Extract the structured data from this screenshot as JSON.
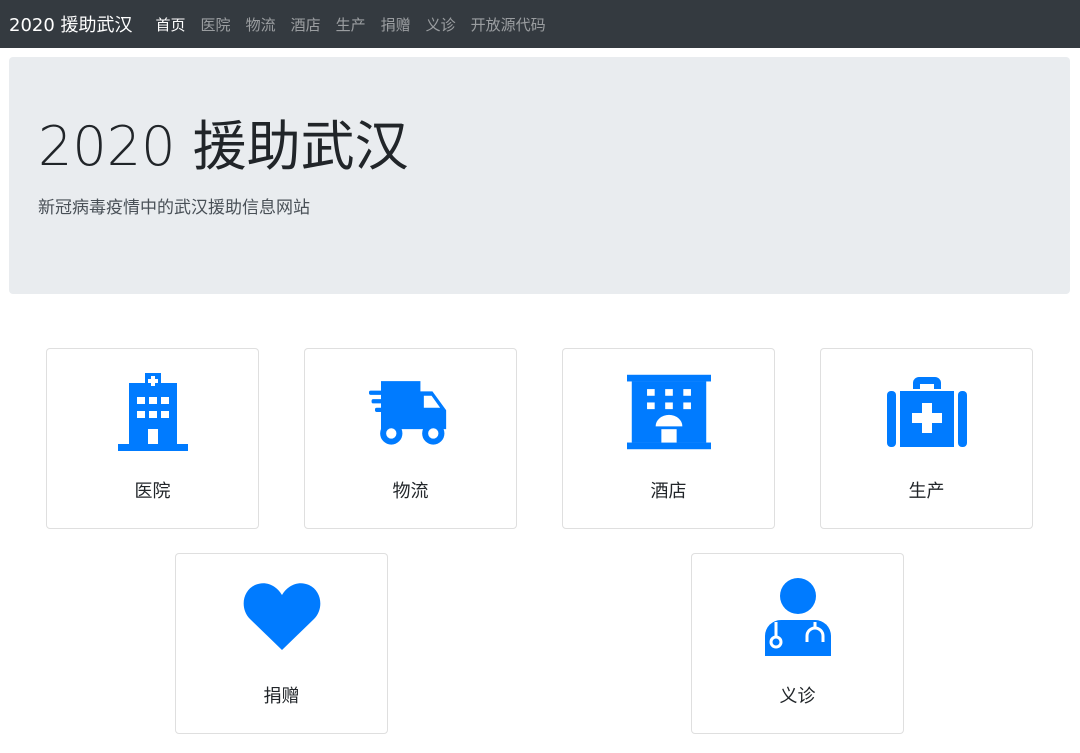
{
  "navbar": {
    "brand": "2020 援助武汉",
    "links": [
      {
        "label": "首页"
      },
      {
        "label": "医院"
      },
      {
        "label": "物流"
      },
      {
        "label": "酒店"
      },
      {
        "label": "生产"
      },
      {
        "label": "捐赠"
      },
      {
        "label": "义诊"
      },
      {
        "label": "开放源代码"
      }
    ]
  },
  "hero": {
    "title": "2020 援助武汉",
    "subtitle": "新冠病毒疫情中的武汉援助信息网站"
  },
  "cards": [
    {
      "label": "医院",
      "icon": "hospital-icon"
    },
    {
      "label": "物流",
      "icon": "truck-icon"
    },
    {
      "label": "酒店",
      "icon": "hotel-icon"
    },
    {
      "label": "生产",
      "icon": "medkit-icon"
    },
    {
      "label": "捐赠",
      "icon": "heart-icon"
    },
    {
      "label": "义诊",
      "icon": "doctor-icon"
    }
  ],
  "colors": {
    "accent": "#007bff",
    "navbar_bg": "#343a40",
    "jumbotron_bg": "#e9ecef"
  }
}
